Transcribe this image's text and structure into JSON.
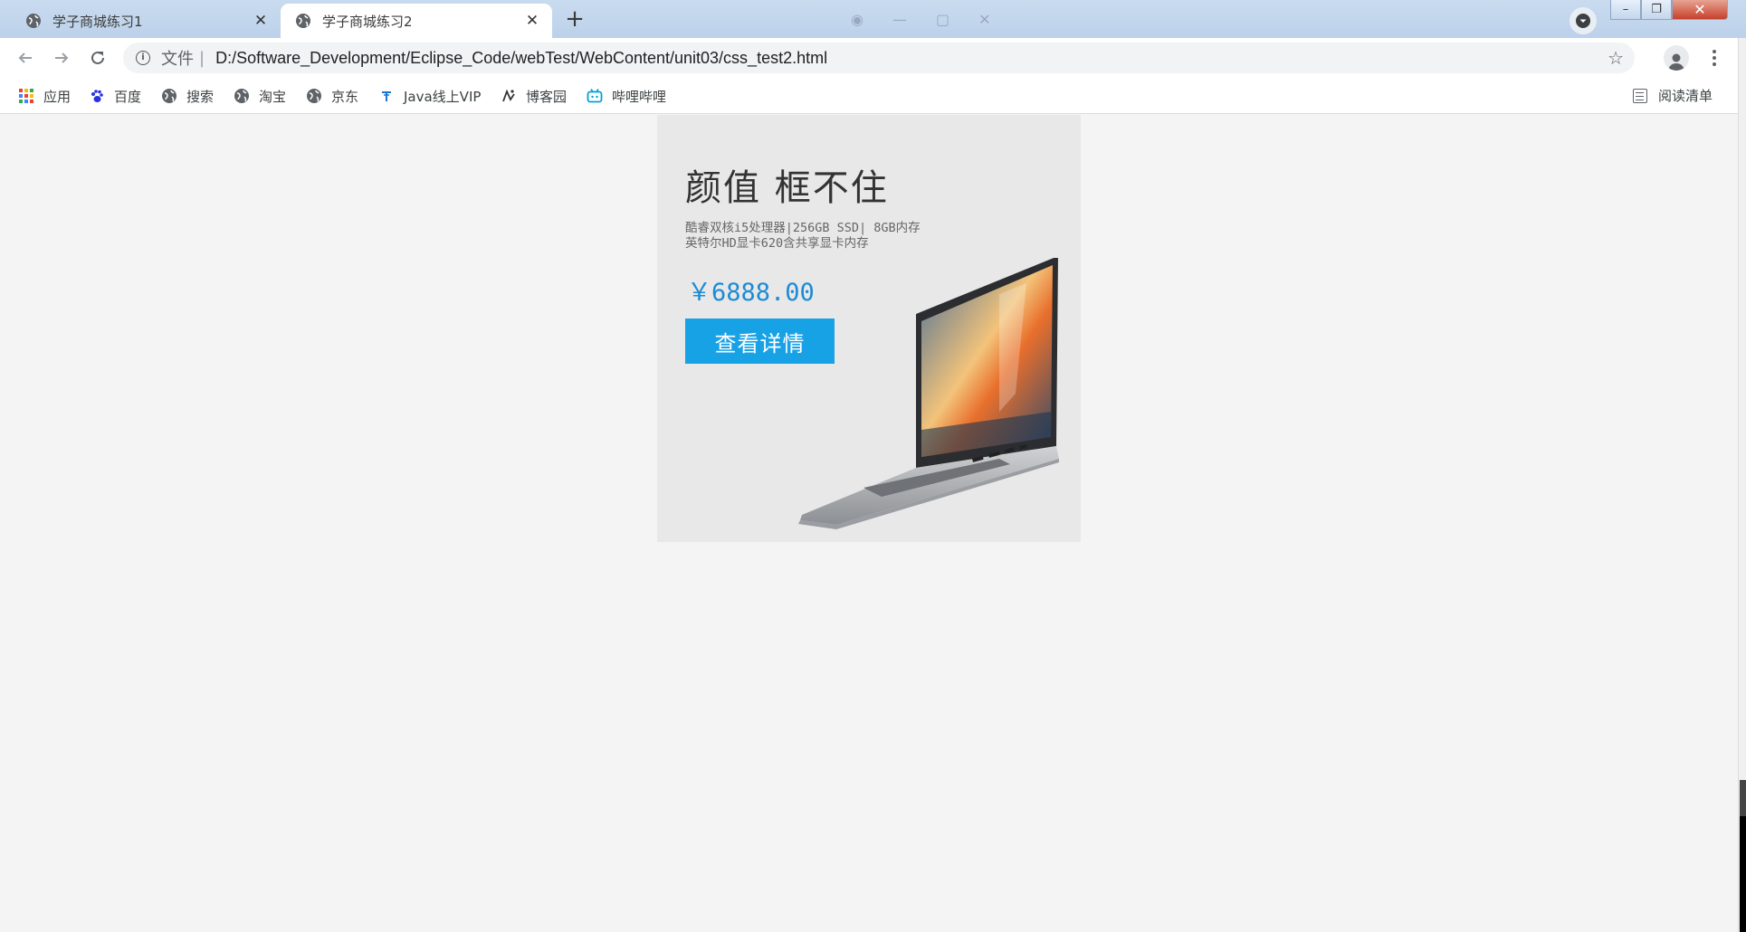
{
  "tabs": [
    {
      "title": "学子商城练习1",
      "close": "✕",
      "active": false
    },
    {
      "title": "学子商城练习2",
      "close": "✕",
      "active": true
    }
  ],
  "new_tab_label": "+",
  "window_controls": {
    "minimize": "–",
    "maximize": "❐",
    "close": "✕"
  },
  "address_bar": {
    "scheme_label": "文件",
    "separator": "|",
    "url": "D:/Software_Development/Eclipse_Code/webTest/WebContent/unit03/css_test2.html"
  },
  "bookmarks": [
    {
      "label": "应用",
      "icon": "apps-grid-icon"
    },
    {
      "label": "百度",
      "icon": "baidu-paw-icon"
    },
    {
      "label": "搜索",
      "icon": "globe-icon"
    },
    {
      "label": "淘宝",
      "icon": "globe-icon"
    },
    {
      "label": "京东",
      "icon": "globe-icon"
    },
    {
      "label": "Java线上VIP",
      "icon": "java-icon"
    },
    {
      "label": "博客园",
      "icon": "cnblogs-icon"
    },
    {
      "label": "哔哩哔哩",
      "icon": "bilibili-icon"
    }
  ],
  "reading_list_label": "阅读清单",
  "product": {
    "headline": "颜值  框不住",
    "spec_line1": "酷睿双核i5处理器|256GB SSD| 8GB内存",
    "spec_line2": "英特尔HD显卡620含共享显卡内存",
    "price": "￥6888.00",
    "button_label": "查看详情"
  },
  "colors": {
    "accent_blue": "#18a2e6",
    "price_blue": "#1c8bd6",
    "card_bg": "#e8e8e8",
    "page_bg": "#f4f4f4"
  }
}
